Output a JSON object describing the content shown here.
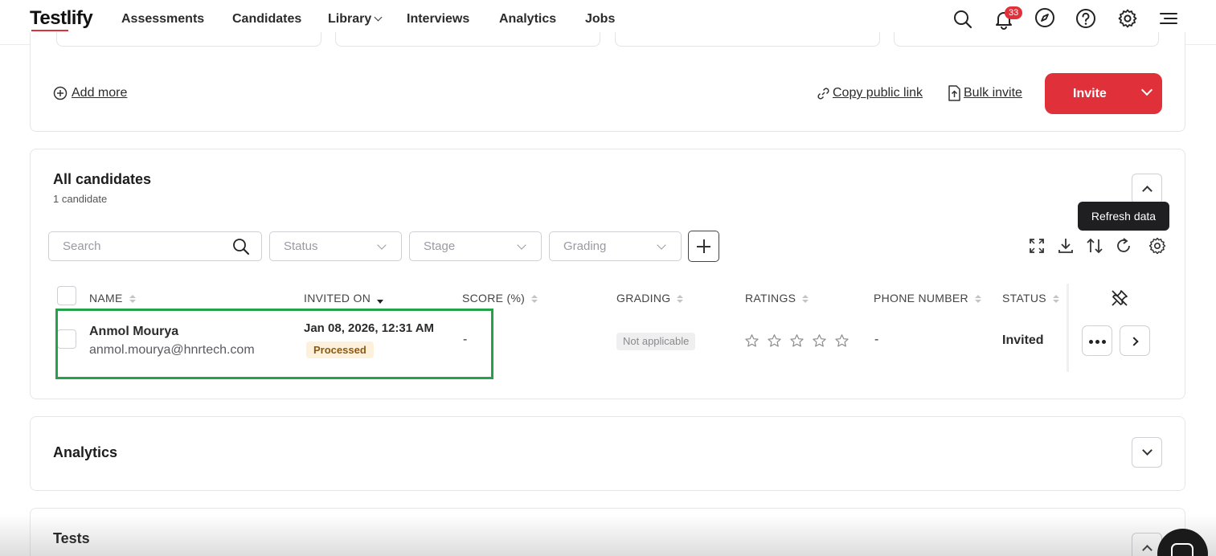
{
  "app": {
    "logo": "Testlify"
  },
  "nav": {
    "items": [
      "Assessments",
      "Candidates",
      "Library",
      "Interviews",
      "Analytics",
      "Jobs"
    ],
    "notifications_count": "33"
  },
  "invite_bar": {
    "add_more": "Add more",
    "copy_link": "Copy public link",
    "bulk_invite": "Bulk invite",
    "invite": "Invite"
  },
  "candidates_section": {
    "title": "All candidates",
    "count": "1 candidate",
    "tooltip": "Refresh data",
    "filters": {
      "search_placeholder": "Search",
      "status": "Status",
      "stage": "Stage",
      "grading": "Grading"
    },
    "columns": [
      "NAME",
      "INVITED ON",
      "SCORE (%)",
      "GRADING",
      "RATINGS",
      "PHONE NUMBER",
      "STATUS"
    ],
    "rows": [
      {
        "name": "Anmol Mourya",
        "email": "anmol.mourya@hnrtech.com",
        "invited_on": "Jan 08, 2026, 12:31 AM",
        "invite_state": "Processed",
        "score": "-",
        "grading": "Not applicable",
        "rating": 0,
        "phone": "-",
        "status": "Invited"
      }
    ]
  },
  "analytics_section": {
    "title": "Analytics"
  },
  "tests_section": {
    "title": "Tests"
  },
  "colors": {
    "brand_red": "#e0313b",
    "highlight_green": "#23a24a",
    "processed_bg": "#fdf1dc"
  }
}
